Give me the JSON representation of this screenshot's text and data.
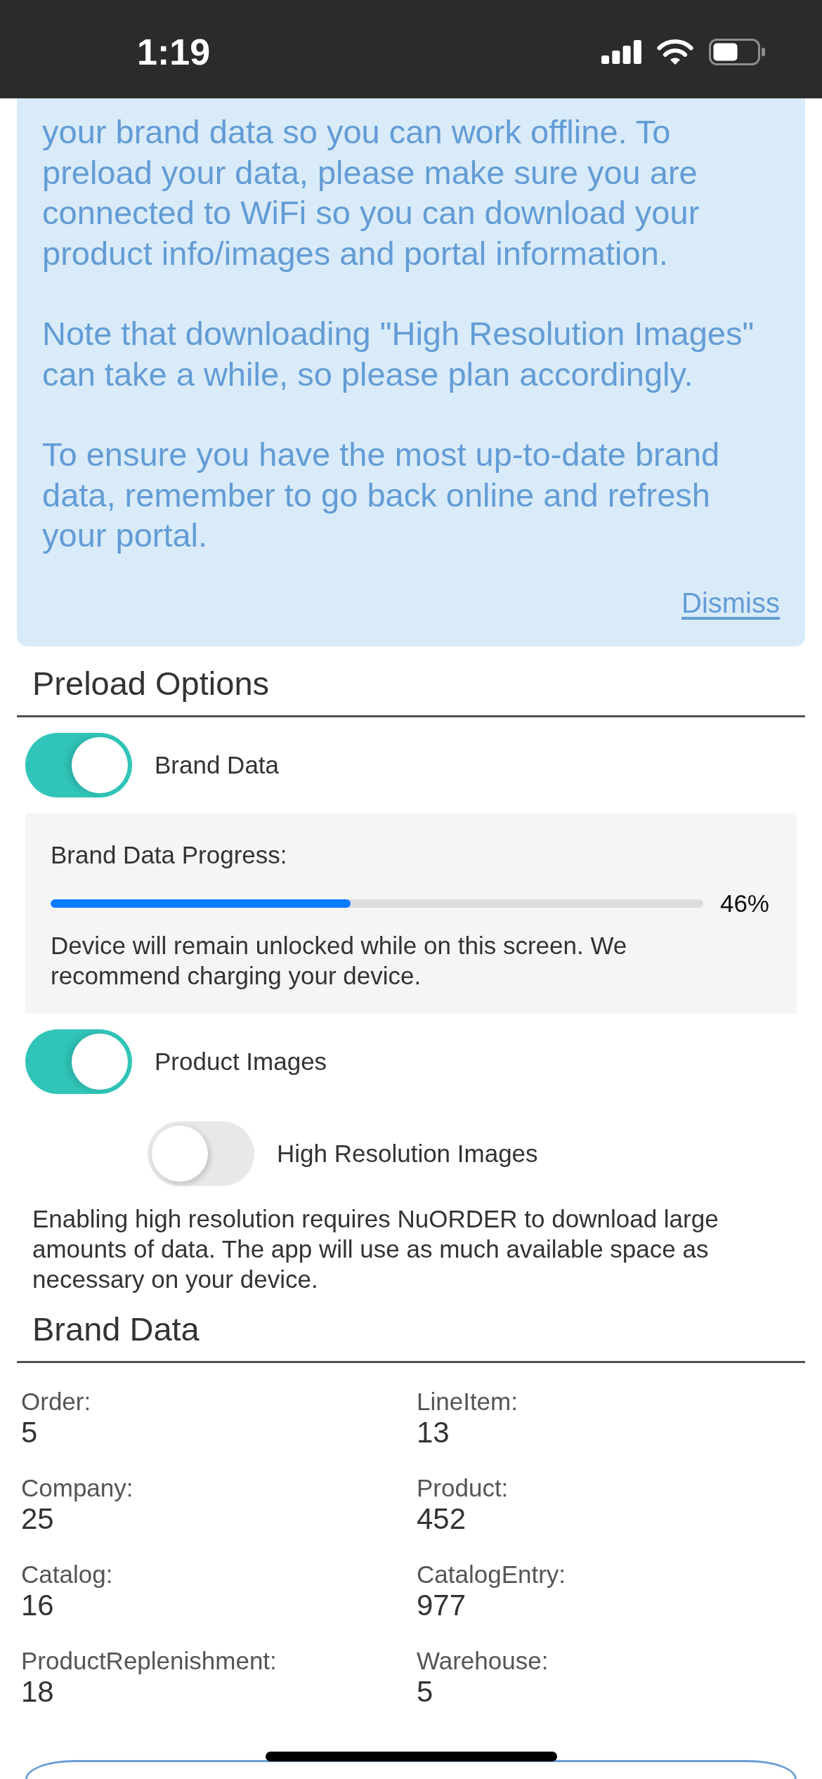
{
  "status_bar": {
    "time": "1:19"
  },
  "info_panel": {
    "paragraphs": [
      "your brand data so you can work offline. To preload your data, please make sure you are connected to WiFi so you can download your product info/images and portal information.",
      "Note that downloading \"High Resolution Images\" can take a while, so please plan accordingly.",
      "To ensure you have the most up-to-date brand data, remember to go back online and refresh your portal."
    ],
    "dismiss": "Dismiss"
  },
  "preload_options": {
    "title": "Preload Options",
    "options": [
      {
        "kind": "toggle",
        "label": "Brand Data",
        "on": true
      },
      {
        "kind": "progress",
        "label": "Brand Data Progress:",
        "level": 0.46,
        "reading": "46%",
        "note": "Device will remain unlocked while on this screen. We recommend charging your device."
      },
      {
        "kind": "toggle",
        "label": "Product Images",
        "on": true,
        "children": [
          {
            "kind": "toggle",
            "label": "High Resolution Images",
            "on": false
          }
        ]
      },
      {
        "kind": "note",
        "text": "Enabling high resolution requires NuORDER to download large amounts of data. The app will use as much available space as necessary on your device."
      }
    ]
  },
  "brand_data": {
    "title": "Brand Data",
    "counts": [
      {
        "label": "Order:",
        "value": "5"
      },
      {
        "label": "LineItem:",
        "value": "13"
      },
      {
        "label": "Company:",
        "value": "25"
      },
      {
        "label": "Product:",
        "value": "452"
      },
      {
        "label": "Catalog:",
        "value": "16"
      },
      {
        "label": "CatalogEntry:",
        "value": "977"
      },
      {
        "label": "ProductReplenishment:",
        "value": "18"
      },
      {
        "label": "Warehouse:",
        "value": "5"
      }
    ]
  }
}
